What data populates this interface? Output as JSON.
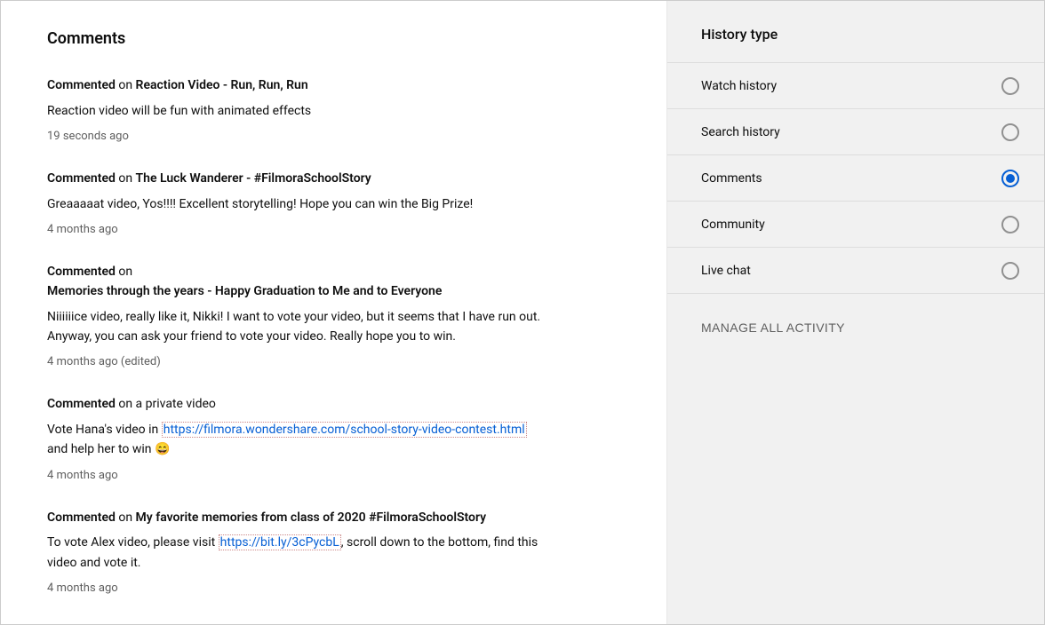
{
  "main": {
    "heading": "Comments",
    "comments": [
      {
        "prefix": "Commented",
        "on": " on ",
        "video": "Reaction Video - Run, Run, Run",
        "body_parts": [
          {
            "t": "text",
            "v": "Reaction video will be fun with animated effects"
          }
        ],
        "timestamp": "19 seconds ago"
      },
      {
        "prefix": "Commented",
        "on": " on ",
        "video": "The Luck Wanderer - #FilmoraSchoolStory",
        "body_parts": [
          {
            "t": "text",
            "v": "Greaaaaat video, Yos!!!! Excellent storytelling! Hope you can win the Big Prize!"
          }
        ],
        "timestamp": "4 months ago"
      },
      {
        "prefix": "Commented",
        "on": " on",
        "video_newline": true,
        "video": "Memories through the years - Happy Graduation to Me and to Everyone",
        "body_parts": [
          {
            "t": "text",
            "v": "Niiiiiice video, really like it, Nikki! I want to vote your video, but it seems that I have run out. Anyway, you can ask your friend to vote your video. Really hope you to win."
          }
        ],
        "timestamp": "4 months ago (edited)"
      },
      {
        "prefix": "Commented",
        "on": " on a private video",
        "video": "",
        "body_parts": [
          {
            "t": "text",
            "v": "Vote Hana's video in "
          },
          {
            "t": "link",
            "v": "https://filmora.wondershare.com/school-story-video-contest.html"
          },
          {
            "t": "text",
            "v": " and help her to win "
          },
          {
            "t": "emoji",
            "v": "😄"
          }
        ],
        "timestamp": "4 months ago"
      },
      {
        "prefix": "Commented",
        "on": " on ",
        "video": "My favorite memories from class of 2020 #FilmoraSchoolStory",
        "body_parts": [
          {
            "t": "text",
            "v": "To vote Alex video, please visit "
          },
          {
            "t": "link",
            "v": "https://bit.ly/3cPycbL"
          },
          {
            "t": "text",
            "v": ", scroll down to the bottom, find this video and vote it."
          }
        ],
        "timestamp": "4 months ago"
      }
    ]
  },
  "sidebar": {
    "heading": "History type",
    "items": [
      {
        "label": "Watch history",
        "selected": false
      },
      {
        "label": "Search history",
        "selected": false
      },
      {
        "label": "Comments",
        "selected": true
      },
      {
        "label": "Community",
        "selected": false
      },
      {
        "label": "Live chat",
        "selected": false
      }
    ],
    "manage_label": "MANAGE ALL ACTIVITY"
  }
}
